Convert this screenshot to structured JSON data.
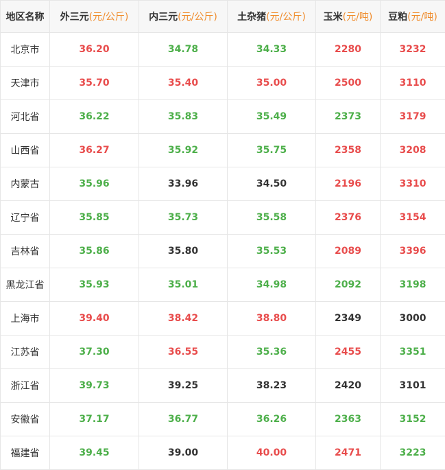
{
  "colors": {
    "up": "#e84c4c",
    "down": "#4daf4a",
    "flat": "#333333",
    "unit": "#f08c2c"
  },
  "headers": [
    {
      "name": "地区名称",
      "unit": ""
    },
    {
      "name": "外三元",
      "unit": "(元/公斤)"
    },
    {
      "name": "内三元",
      "unit": "(元/公斤)"
    },
    {
      "name": "土杂猪",
      "unit": "(元/公斤)"
    },
    {
      "name": "玉米",
      "unit": "(元/吨)"
    },
    {
      "name": "豆粕",
      "unit": "(元/吨)"
    }
  ],
  "rows": [
    {
      "region": "北京市",
      "cells": [
        {
          "v": "36.20",
          "c": "red"
        },
        {
          "v": "34.78",
          "c": "green"
        },
        {
          "v": "34.33",
          "c": "green"
        },
        {
          "v": "2280",
          "c": "red"
        },
        {
          "v": "3232",
          "c": "red"
        }
      ]
    },
    {
      "region": "天津市",
      "cells": [
        {
          "v": "35.70",
          "c": "red"
        },
        {
          "v": "35.40",
          "c": "red"
        },
        {
          "v": "35.00",
          "c": "red"
        },
        {
          "v": "2500",
          "c": "red"
        },
        {
          "v": "3110",
          "c": "red"
        }
      ]
    },
    {
      "region": "河北省",
      "cells": [
        {
          "v": "36.22",
          "c": "green"
        },
        {
          "v": "35.83",
          "c": "green"
        },
        {
          "v": "35.49",
          "c": "green"
        },
        {
          "v": "2373",
          "c": "green"
        },
        {
          "v": "3179",
          "c": "red"
        }
      ]
    },
    {
      "region": "山西省",
      "cells": [
        {
          "v": "36.27",
          "c": "red"
        },
        {
          "v": "35.92",
          "c": "green"
        },
        {
          "v": "35.75",
          "c": "green"
        },
        {
          "v": "2358",
          "c": "red"
        },
        {
          "v": "3208",
          "c": "red"
        }
      ]
    },
    {
      "region": "内蒙古",
      "cells": [
        {
          "v": "35.96",
          "c": "green"
        },
        {
          "v": "33.96",
          "c": "black"
        },
        {
          "v": "34.50",
          "c": "black"
        },
        {
          "v": "2196",
          "c": "red"
        },
        {
          "v": "3310",
          "c": "red"
        }
      ]
    },
    {
      "region": "辽宁省",
      "cells": [
        {
          "v": "35.85",
          "c": "green"
        },
        {
          "v": "35.73",
          "c": "green"
        },
        {
          "v": "35.58",
          "c": "green"
        },
        {
          "v": "2376",
          "c": "red"
        },
        {
          "v": "3154",
          "c": "red"
        }
      ]
    },
    {
      "region": "吉林省",
      "cells": [
        {
          "v": "35.86",
          "c": "green"
        },
        {
          "v": "35.80",
          "c": "black"
        },
        {
          "v": "35.53",
          "c": "green"
        },
        {
          "v": "2089",
          "c": "red"
        },
        {
          "v": "3396",
          "c": "red"
        }
      ]
    },
    {
      "region": "黑龙江省",
      "cells": [
        {
          "v": "35.93",
          "c": "green"
        },
        {
          "v": "35.01",
          "c": "green"
        },
        {
          "v": "34.98",
          "c": "green"
        },
        {
          "v": "2092",
          "c": "green"
        },
        {
          "v": "3198",
          "c": "green"
        }
      ]
    },
    {
      "region": "上海市",
      "cells": [
        {
          "v": "39.40",
          "c": "red"
        },
        {
          "v": "38.42",
          "c": "red"
        },
        {
          "v": "38.80",
          "c": "red"
        },
        {
          "v": "2349",
          "c": "black"
        },
        {
          "v": "3000",
          "c": "black"
        }
      ]
    },
    {
      "region": "江苏省",
      "cells": [
        {
          "v": "37.30",
          "c": "green"
        },
        {
          "v": "36.55",
          "c": "red"
        },
        {
          "v": "35.36",
          "c": "green"
        },
        {
          "v": "2455",
          "c": "red"
        },
        {
          "v": "3351",
          "c": "green"
        }
      ]
    },
    {
      "region": "浙江省",
      "cells": [
        {
          "v": "39.73",
          "c": "green"
        },
        {
          "v": "39.25",
          "c": "black"
        },
        {
          "v": "38.23",
          "c": "black"
        },
        {
          "v": "2420",
          "c": "black"
        },
        {
          "v": "3101",
          "c": "black"
        }
      ]
    },
    {
      "region": "安徽省",
      "cells": [
        {
          "v": "37.17",
          "c": "green"
        },
        {
          "v": "36.77",
          "c": "green"
        },
        {
          "v": "36.26",
          "c": "green"
        },
        {
          "v": "2363",
          "c": "green"
        },
        {
          "v": "3152",
          "c": "green"
        }
      ]
    },
    {
      "region": "福建省",
      "cells": [
        {
          "v": "39.45",
          "c": "green"
        },
        {
          "v": "39.00",
          "c": "black"
        },
        {
          "v": "40.00",
          "c": "red"
        },
        {
          "v": "2471",
          "c": "red"
        },
        {
          "v": "3223",
          "c": "green"
        }
      ]
    }
  ]
}
